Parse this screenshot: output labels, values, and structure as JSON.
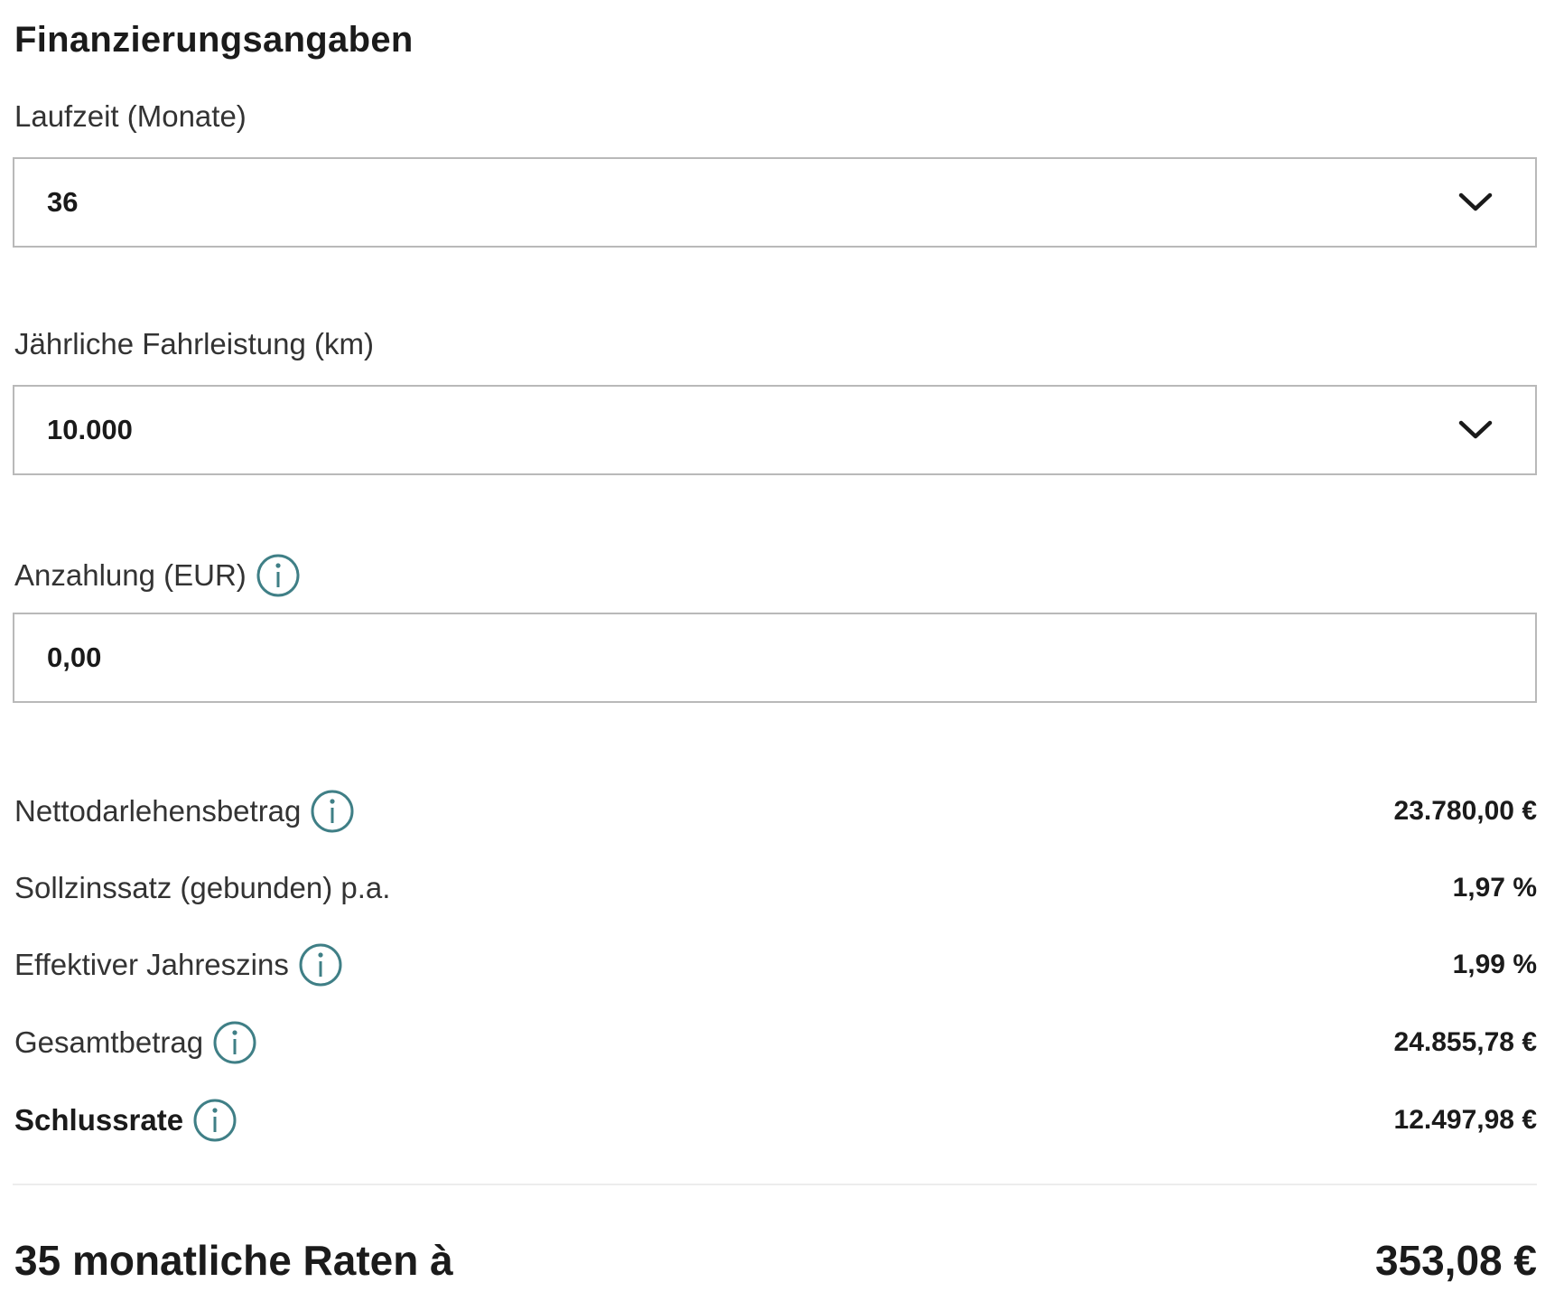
{
  "section": {
    "title": "Finanzierungsangaben"
  },
  "fields": {
    "laufzeit": {
      "label": "Laufzeit (Monate)",
      "value": "36",
      "icon": "chevron-down-icon"
    },
    "fahrleistung": {
      "label": "Jährliche Fahrleistung (km)",
      "value": "10.000",
      "icon": "chevron-down-icon"
    },
    "anzahlung": {
      "label": "Anzahlung (EUR)",
      "value": "0,00",
      "icon": "info-icon"
    }
  },
  "summary": [
    {
      "label": "Nettodarlehensbetrag",
      "value": "23.780,00 €",
      "info": true
    },
    {
      "label": "Sollzinssatz (gebunden) p.a.",
      "value": "1,97 %",
      "info": false
    },
    {
      "label": "Effektiver Jahreszins",
      "value": "1,99 %",
      "info": true
    },
    {
      "label": "Gesamtbetrag",
      "value": "24.855,78 €",
      "info": true
    },
    {
      "label": "Schlussrate",
      "value": "12.497,98 €",
      "info": true
    }
  ],
  "total": {
    "label": "35 monatliche Raten à",
    "value": "353,08 €"
  },
  "colors": {
    "info_icon": "#3f7f86",
    "field_border": "#b9b9b9",
    "text": "#333333"
  }
}
